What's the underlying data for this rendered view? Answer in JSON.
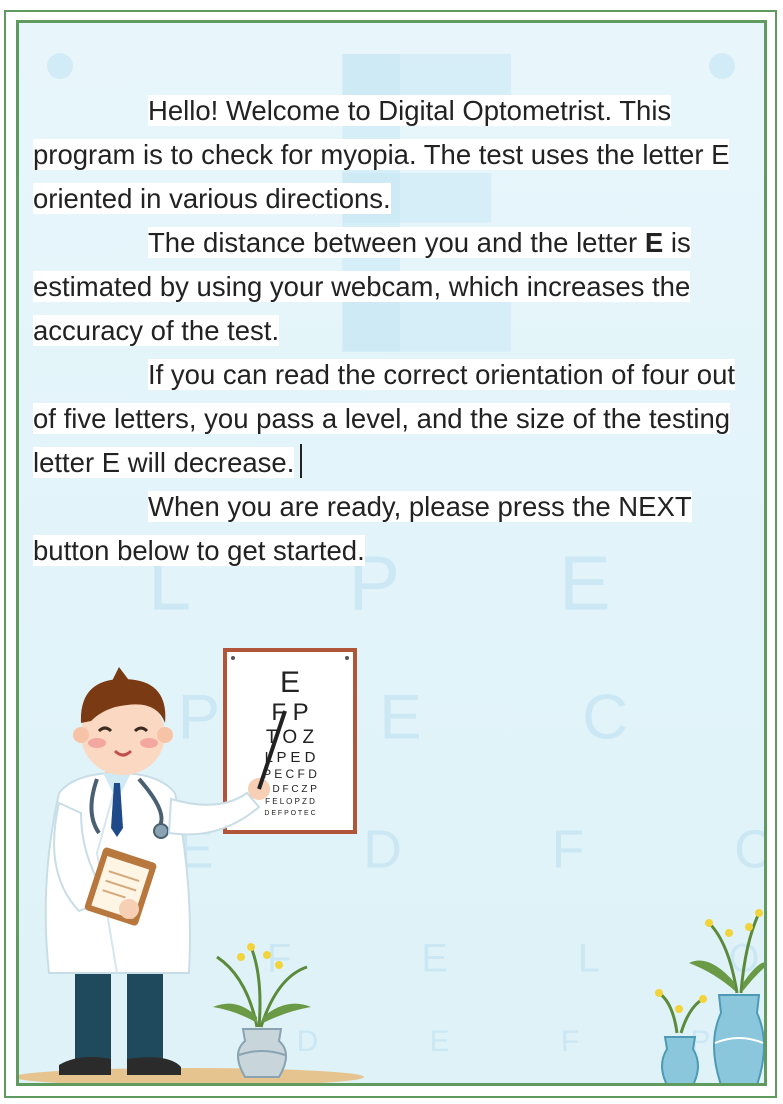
{
  "intro": {
    "p1": "Hello! Welcome to Digital Optometrist. This program is to check for myopia. The test uses the letter E oriented in various directions.",
    "p2_before": "The distance between you and the letter ",
    "p2_bold": "E",
    "p2_after": " is estimated by using your webcam, which increases the accuracy of the test.",
    "p3": "If you can read the correct orientation of four out of five letters, you pass a level, and the size of the testing letter E will decrease.",
    "p4": "When you are ready, please press the NEXT button below to get started."
  },
  "eye_chart": {
    "rows": [
      "E",
      "F P",
      "T O Z",
      "L P E D",
      "P E C F D",
      "E D F C Z P",
      "F E L O P Z D",
      "D E F P O T E C"
    ]
  },
  "background_letters": {
    "rows": [
      "L P E D",
      "P E C F D",
      "E D F C Z P",
      "F E L O P Z D"
    ]
  },
  "colors": {
    "frame": "#5f9a5e",
    "background": "#e4f5fb",
    "faint_letters": "#c4e4f2"
  }
}
